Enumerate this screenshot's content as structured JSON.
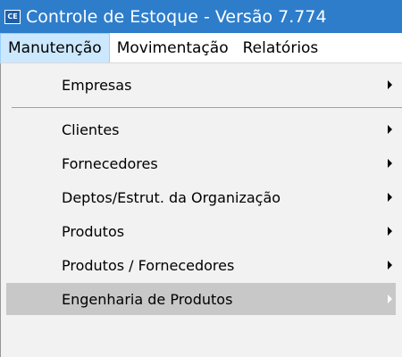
{
  "window": {
    "icon_text": "CE",
    "title": "Controle de Estoque - Versão 7.774"
  },
  "menubar": {
    "items": [
      "Manutenção",
      "Movimentação",
      "Relatórios"
    ]
  },
  "dropdown": {
    "items": [
      "Empresas",
      "Clientes",
      "Fornecedores",
      "Deptos/Estrut. da Organização",
      "Produtos",
      "Produtos / Fornecedores",
      "Engenharia de Produtos"
    ]
  },
  "colors": {
    "titlebar": "#2e7dcb",
    "highlight": "#c8c8c8",
    "menubar_active": "#cce8ff"
  }
}
